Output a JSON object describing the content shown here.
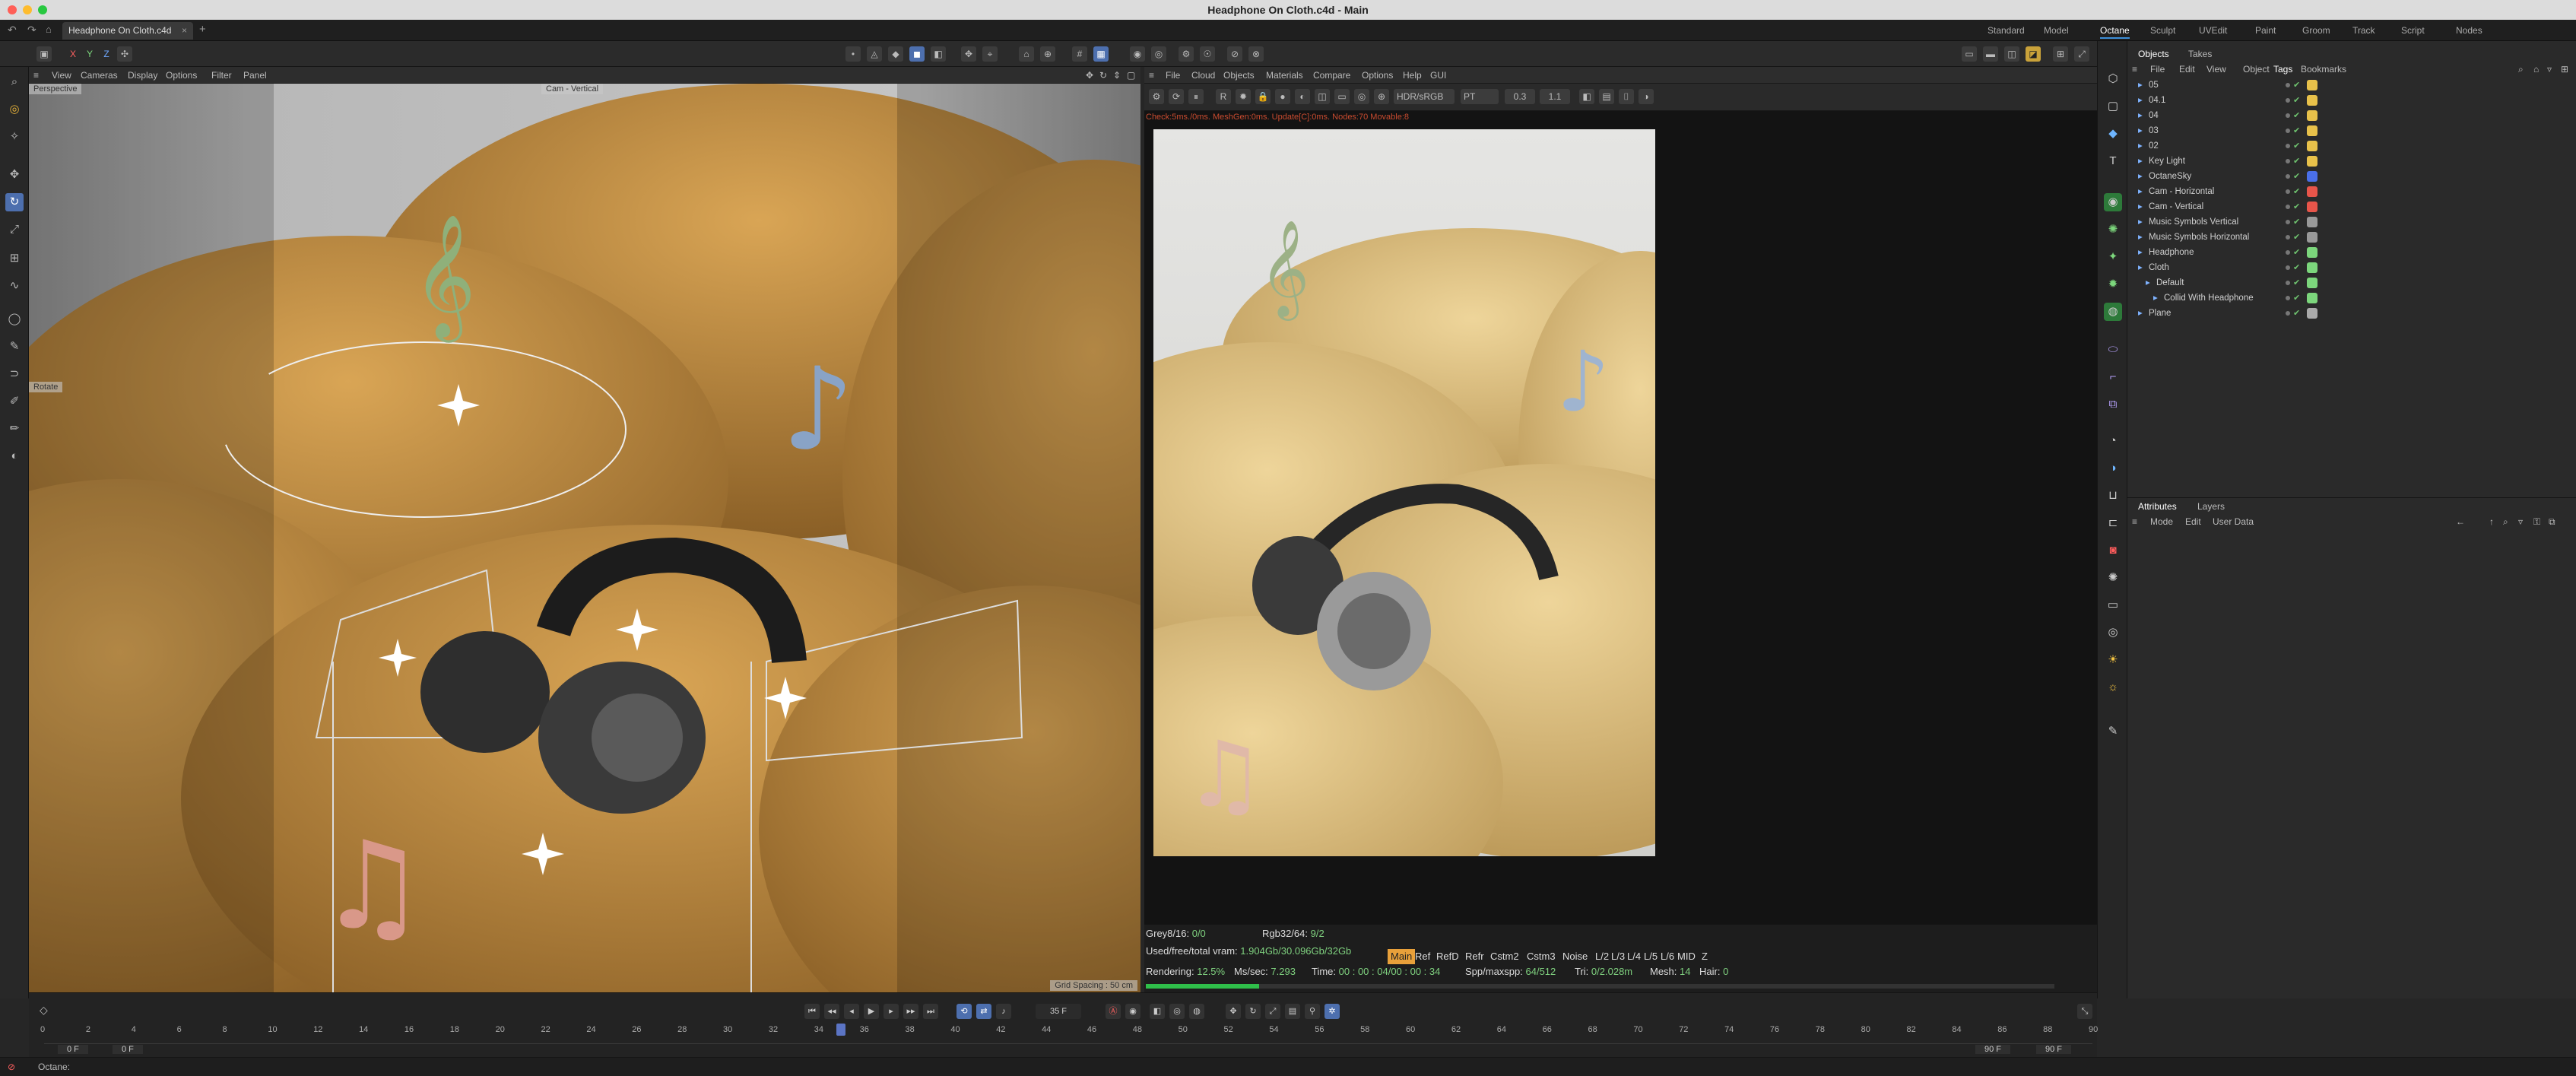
{
  "window": {
    "title": "Headphone On Cloth.c4d - Main"
  },
  "tab": {
    "label": "Headphone On Cloth.c4d"
  },
  "layouts": [
    "Standard",
    "Model",
    "Octane",
    "Sculpt",
    "UVEdit",
    "Paint",
    "Groom",
    "Track",
    "Script",
    "Nodes"
  ],
  "active_layout": "Octane",
  "toolbar": {
    "axis_labels": [
      "X",
      "Y",
      "Z"
    ]
  },
  "viewport": {
    "menu": [
      "View",
      "Cameras",
      "Display",
      "Options",
      "Filter",
      "Panel"
    ],
    "name": "Perspective",
    "camera": "Cam - Vertical",
    "tool_label": "Rotate",
    "grid_spacing": "Grid Spacing : 50 cm"
  },
  "render_view": {
    "menu": [
      "File",
      "Cloud",
      "Objects",
      "Materials",
      "Compare",
      "Options",
      "Help",
      "GUI"
    ],
    "color_space": "HDR/sRGB",
    "kernel": "PT",
    "value_a": "0.3",
    "value_b": "1.1",
    "info_line": "Check:5ms./0ms. MeshGen:0ms. Update[C]:0ms. Nodes:70 Movable:8",
    "stats": {
      "grey_label": "Grey8/16:",
      "grey_value": "0/0",
      "rgb_label": "Rgb32/64:",
      "rgb_value": "9/2",
      "vram_label": "Used/free/total vram:",
      "vram_value": "1.904Gb/30.096Gb/32Gb",
      "rendering_label": "Rendering:",
      "rendering_value": "12.5%",
      "mssec_label": "Ms/sec:",
      "mssec_value": "7.293",
      "time_label": "Time:",
      "time_value": "00 : 00 : 04/00 : 00 : 34",
      "spp_label": "Spp/maxspp:",
      "spp_value": "64/512",
      "tri_label": "Tri:",
      "tri_value": "0/2.028m",
      "mesh_label": "Mesh:",
      "mesh_value": "14",
      "hair_label": "Hair:",
      "hair_value": "0"
    },
    "channels": [
      "Main",
      "Ref",
      "RefD",
      "Refr",
      "Cstm2",
      "Cstm3",
      "Noise",
      "L/2",
      "L/3",
      "L/4",
      "L/5",
      "L/6",
      "MID",
      "Z"
    ],
    "active_channel": "Main",
    "progress": 0.125
  },
  "objects_panel": {
    "tabs": [
      "Objects",
      "Takes"
    ],
    "menu": [
      "File",
      "Edit",
      "View",
      "Object",
      "Tags",
      "Bookmarks"
    ],
    "objects": [
      {
        "name": "05",
        "indent": 1
      },
      {
        "name": "04.1",
        "indent": 1
      },
      {
        "name": "04",
        "indent": 1
      },
      {
        "name": "03",
        "indent": 1
      },
      {
        "name": "02",
        "indent": 1
      },
      {
        "name": "Key Light",
        "indent": 1
      },
      {
        "name": "OctaneSky",
        "indent": 1
      },
      {
        "name": "Cam - Horizontal",
        "indent": 1
      },
      {
        "name": "Cam - Vertical",
        "indent": 1
      },
      {
        "name": "Music Symbols Vertical",
        "indent": 1
      },
      {
        "name": "Music Symbols Horizontal",
        "indent": 1
      },
      {
        "name": "Headphone",
        "indent": 1
      },
      {
        "name": "Cloth",
        "indent": 1
      },
      {
        "name": "Default",
        "indent": 2
      },
      {
        "name": "Collid With Headphone",
        "indent": 3
      },
      {
        "name": "Plane",
        "indent": 1
      }
    ]
  },
  "attributes_panel": {
    "tabs": [
      "Attributes",
      "Layers"
    ],
    "menu": [
      "Mode",
      "Edit",
      "User Data"
    ]
  },
  "timeline": {
    "ticks": [
      "0",
      "2",
      "4",
      "6",
      "8",
      "10",
      "12",
      "14",
      "16",
      "18",
      "20",
      "22",
      "24",
      "26",
      "28",
      "30",
      "32",
      "34",
      "36",
      "38",
      "40",
      "42",
      "44",
      "46",
      "48",
      "50",
      "52",
      "54",
      "56",
      "58",
      "60",
      "62",
      "64",
      "66",
      "68",
      "70",
      "72",
      "74",
      "76",
      "78",
      "80",
      "82",
      "84",
      "86",
      "88",
      "90"
    ],
    "current_frame": "35 F",
    "start_a": "0 F",
    "start_b": "0 F",
    "end_a": "90 F",
    "end_b": "90 F",
    "playhead_frame": 35
  },
  "status": {
    "text": "Octane:"
  }
}
